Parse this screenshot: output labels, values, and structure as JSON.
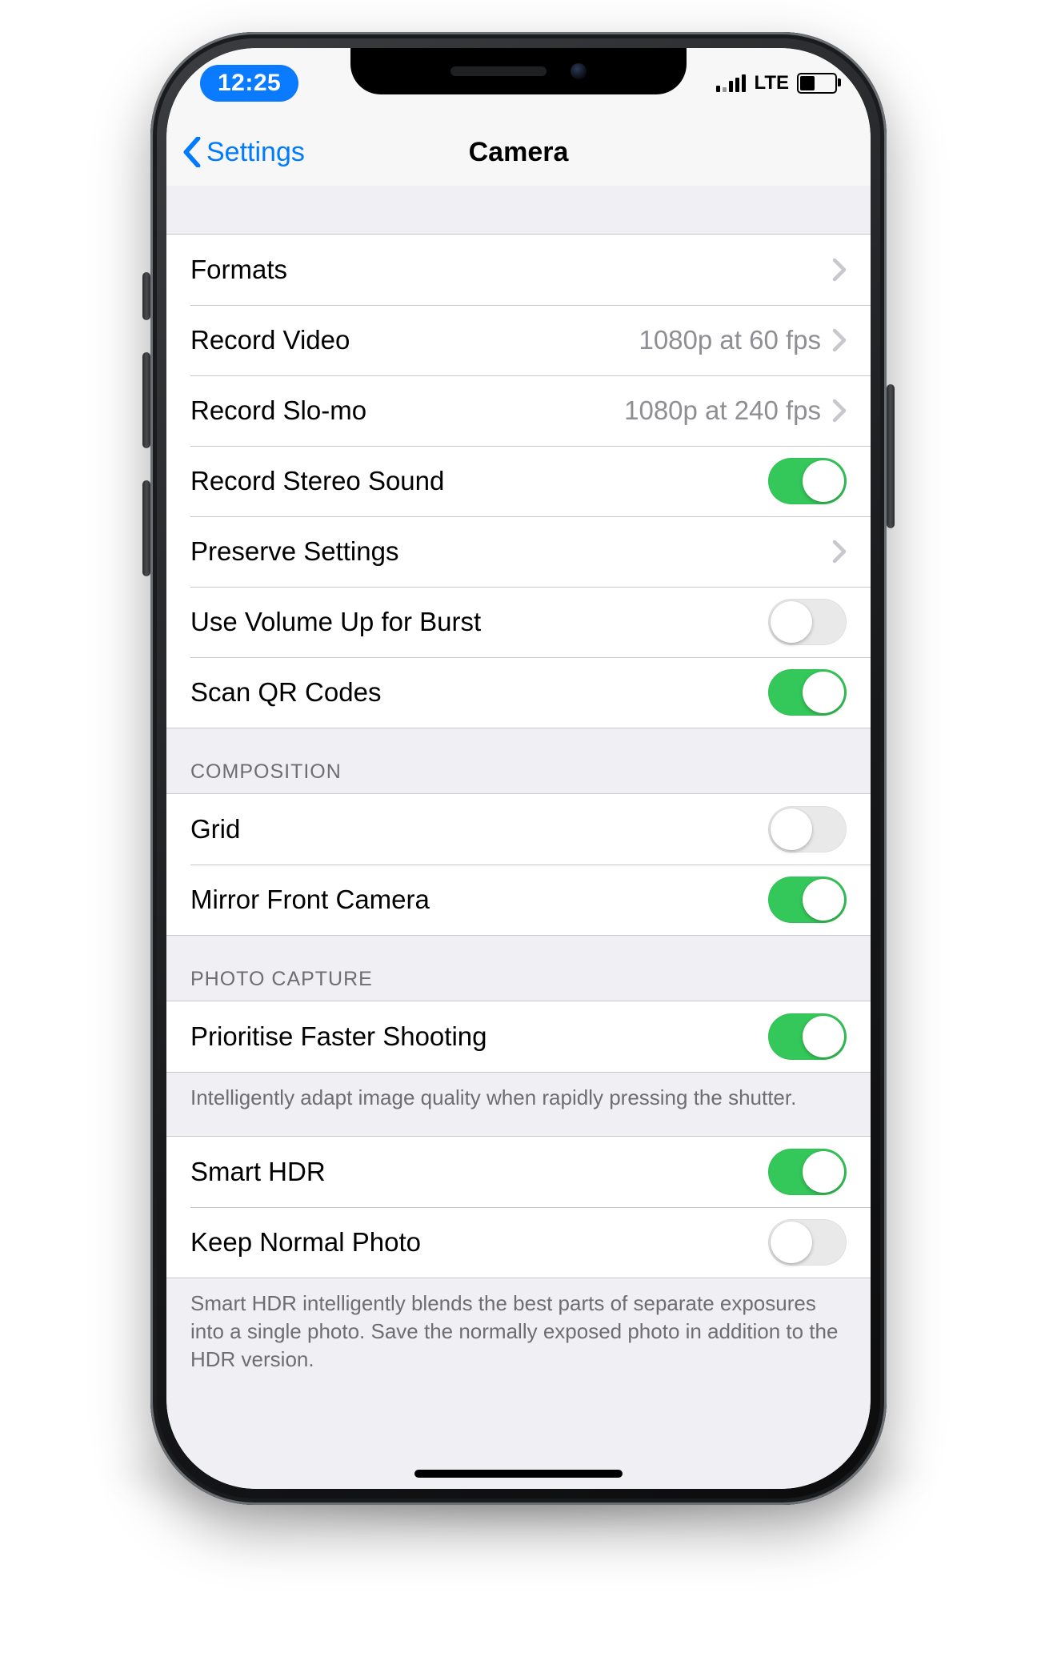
{
  "status": {
    "time": "12:25",
    "carrier_label": "LTE"
  },
  "nav": {
    "back_label": "Settings",
    "title": "Camera"
  },
  "sections": {
    "main": {
      "formats": {
        "label": "Formats"
      },
      "record_video": {
        "label": "Record Video",
        "value": "1080p at 60 fps"
      },
      "record_slomo": {
        "label": "Record Slo-mo",
        "value": "1080p at 240 fps"
      },
      "stereo": {
        "label": "Record Stereo Sound",
        "on": true
      },
      "preserve": {
        "label": "Preserve Settings"
      },
      "vol_burst": {
        "label": "Use Volume Up for Burst",
        "on": false
      },
      "scan_qr": {
        "label": "Scan QR Codes",
        "on": true
      }
    },
    "composition": {
      "header": "COMPOSITION",
      "grid": {
        "label": "Grid",
        "on": false
      },
      "mirror": {
        "label": "Mirror Front Camera",
        "on": true
      }
    },
    "photo_capture": {
      "header": "PHOTO CAPTURE",
      "prioritise": {
        "label": "Prioritise Faster Shooting",
        "on": true
      },
      "prioritise_note": "Intelligently adapt image quality when rapidly pressing the shutter.",
      "smart_hdr": {
        "label": "Smart HDR",
        "on": true
      },
      "keep_normal": {
        "label": "Keep Normal Photo",
        "on": false
      },
      "hdr_note": "Smart HDR intelligently blends the best parts of separate exposures into a single photo. Save the normally exposed photo in addition to the HDR version."
    }
  }
}
